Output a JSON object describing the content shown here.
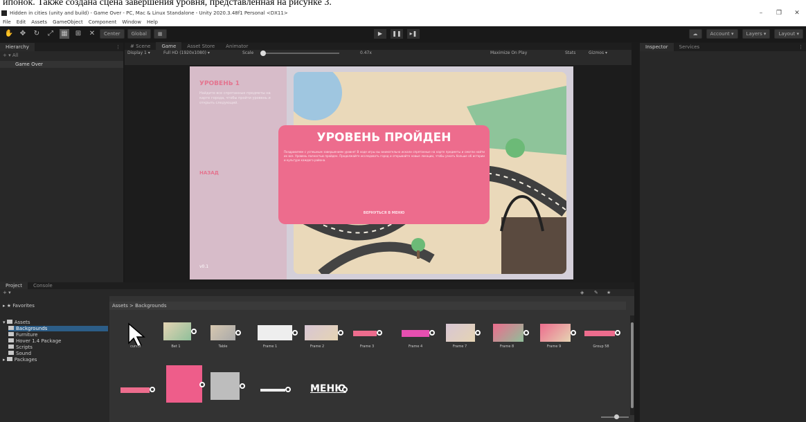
{
  "doc_caption": "ипонок. Также создана сцена завершения уровня, представленная на рисунке 3.",
  "window": {
    "title": "Hidden in cities (unity and build) - Game Over - PC, Mac & Linux Standalone - Unity 2020.3.48f1 Personal <DX11>",
    "min": "–",
    "max": "❐",
    "close": "✕"
  },
  "menu": [
    "File",
    "Edit",
    "Assets",
    "GameObject",
    "Component",
    "Window",
    "Help"
  ],
  "toolbar": {
    "center": "Center",
    "global": "Global",
    "play": "▶",
    "pause": "❚❚",
    "step": "▸❚",
    "account": "Account ▾",
    "layers": "Layers ▾",
    "layout": "Layout ▾"
  },
  "hierarchy": {
    "tab": "Hierarchy",
    "search": "+ ▾  All",
    "scene": "Game Over"
  },
  "center_tabs": [
    "# Scene",
    "Game",
    "Asset Store",
    "Animator"
  ],
  "game_bar": {
    "display": "Display 1 ▾",
    "resolution": "Full HD (1920x1080) ▾",
    "scale_label": "Scale",
    "scale_value": "0.47x",
    "maximize": "Maximize On Play",
    "stats": "Stats",
    "gizmos": "Gizmos ▾"
  },
  "game": {
    "side_title": "УРОВЕНЬ 1",
    "side_text": "Найдите все спрятанные предметы на карте города, чтобы пройти уровень и открыть следующий.",
    "side_button": "НАЗАД",
    "side_footer": "v0.1",
    "modal_title": "УРОВЕНЬ ПРОЙДЕН",
    "modal_text": "Поздравляем с успешным завершением уровня! В ходе игры вы внимательно искали спрятанные на карте предметы и смогли найти их все. Уровень полностью пройден. Продолжайте исследовать город и открывайте новые локации, чтобы узнать больше об истории и культуре каждого района.",
    "modal_button": "ВЕРНУТЬСЯ В МЕНЮ"
  },
  "inspector": {
    "tabs": [
      "Inspector",
      "Services"
    ]
  },
  "project": {
    "tabs": [
      "Project",
      "Console"
    ],
    "tree": {
      "favorites": "Favorites",
      "assets": "Assets",
      "backgrounds": "Backgrounds",
      "furniture": "Furniture",
      "hover": "Hover 1.4 Package",
      "scripts": "Scripts",
      "sound": "Sound",
      "packages": "Packages"
    },
    "breadcrumb": "Assets > Backgrounds",
    "row1": [
      "cursor",
      "Bet 1",
      "Table",
      "Frame 1",
      "Frame 2",
      "Frame 3",
      "Frame 4",
      "Frame 7",
      "Frame 8",
      "Frame 9",
      "Group 58"
    ],
    "row2_text": "МЕНЮ"
  },
  "colors": {
    "accent": "#ed6c8d",
    "selection": "#2c5d87",
    "editor_bg": "#282828"
  }
}
